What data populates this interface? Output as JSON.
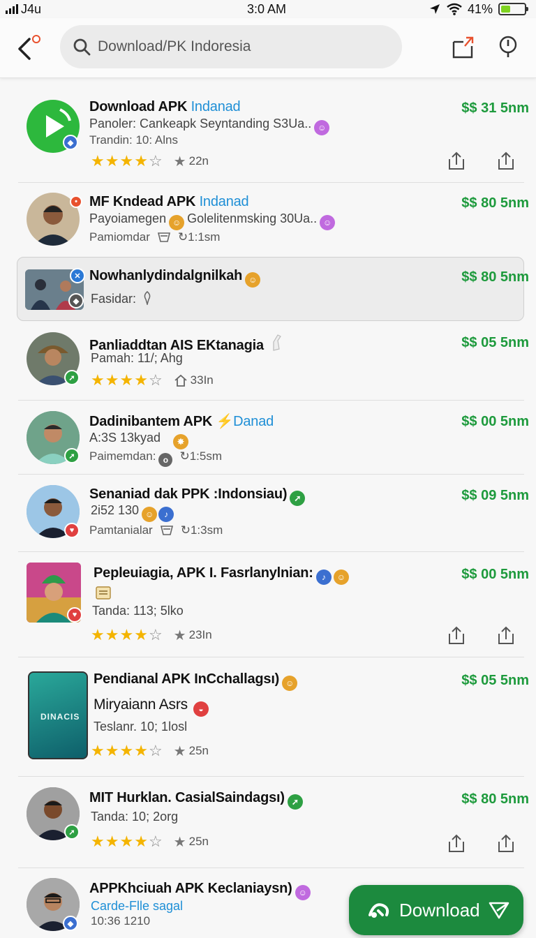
{
  "status": {
    "carrier": "J4u",
    "time": "3:0 AM",
    "battery_pct": "41%",
    "battery_level": 0.41
  },
  "search": {
    "placeholder": "Download/PK Indoresia"
  },
  "colors": {
    "price_green": "#1d9a3c",
    "link_blue": "#1f8fd6",
    "star_gold": "#f4b400",
    "fab_green": "#1c8a3e"
  },
  "rows": [
    {
      "title": "Download APK",
      "title_link": "Indanad",
      "price": "$$ 31 5nm",
      "line1": "Panoler: Cankeapk Seyntanding S3Ua..",
      "line2": "Trandin: 10: Alns",
      "rating_count": "22n",
      "rating": 4
    },
    {
      "title": "MF Kndead APK",
      "title_link": "Indanad",
      "price": "$$ 80 5nm",
      "line1_a": "Payoiamegen",
      "line1_b": "Golelitenmsking 30Ua..",
      "line2_a": "Pamiomdar",
      "line2_b": "1:1sm"
    },
    {
      "title": "Nowhanlydindalgnilkah",
      "price": "$$ 80 5nm",
      "line1": "Fasidar:"
    },
    {
      "title": "Panliaddtan AIS EKtanagia",
      "price": "$$ 05 5nm",
      "line1": "Pamah: 11/; Ahg",
      "rating_count": "33In",
      "rating": 4
    },
    {
      "title": "Dadinibantem APK",
      "title_link": "Danad",
      "price": "$$ 00 5nm",
      "line1": "A:3S 13kyad",
      "line2_a": "Paimemdan:",
      "line2_b": "1:5sm"
    },
    {
      "title": "Senaniad dak PPK :Indonsiau)",
      "price": "$$ 09 5nm",
      "line1": "2i52 130",
      "line2_a": "Pamtanialar",
      "line2_b": "1:3sm"
    },
    {
      "title": "Pepleuiagia, APK I. Fasrlanylnian:",
      "price": "$$ 00 5nm",
      "line1": "Tanda: 113; 5lko",
      "rating_count": "23In",
      "rating": 4
    },
    {
      "title": "Pendianal APK InCchallagsı)",
      "title2": "Miryaiann Asrs",
      "price": "$$ 05 5nm",
      "line1": "Teslanr. 10; 1losl",
      "rating_count": "25n",
      "rating": 4,
      "phone_text": "DINACIS"
    },
    {
      "title": "MIT Hurklan. CasialSaindagsı)",
      "price": "$$ 80 5nm",
      "line1": "Tanda: 10; 2org",
      "rating_count": "25n",
      "rating": 4
    },
    {
      "title": "APPKhciuah APK Keclaniaysn)",
      "line1": "Carde-Flle sagal",
      "line2": "10:36 1210"
    }
  ],
  "fab": {
    "label": "Download"
  }
}
